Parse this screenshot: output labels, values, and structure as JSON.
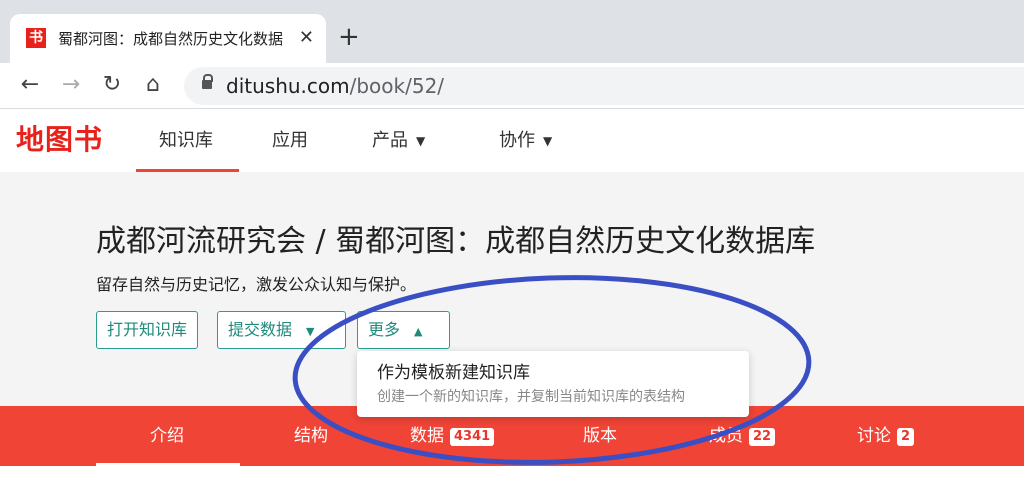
{
  "browser": {
    "tab_title": "蜀都河图：成都自然历史文化数据",
    "tab_close": "✕",
    "new_tab": "+",
    "url_domain": "ditushu.com",
    "url_path": "/book/52/"
  },
  "site": {
    "logo": "地图书",
    "nav": [
      {
        "label": "知识库"
      },
      {
        "label": "应用"
      },
      {
        "label": "产品"
      },
      {
        "label": "协作"
      }
    ]
  },
  "book": {
    "title": "成都河流研究会 / 蜀都河图：成都自然历史文化数据库",
    "description": "留存自然与历史记忆，激发公众认知与保护。",
    "buttons": {
      "open": "打开知识库",
      "submit": "提交数据",
      "more": "更多"
    },
    "more_menu": {
      "item_title": "作为模板新建知识库",
      "item_desc": "创建一个新的知识库，并复制当前知识库的表结构"
    }
  },
  "section_tabs": [
    {
      "label": "介绍"
    },
    {
      "label": "结构"
    },
    {
      "label": "数据",
      "badge": "4341"
    },
    {
      "label": "版本"
    },
    {
      "label": "成员",
      "badge": "22"
    },
    {
      "label": "讨论",
      "badge": "2"
    }
  ],
  "colors": {
    "brand_red": "#e8211b",
    "tab_bar": "#f04437",
    "button_teal": "#2a9d8f",
    "annotation": "#3a4fc4"
  }
}
